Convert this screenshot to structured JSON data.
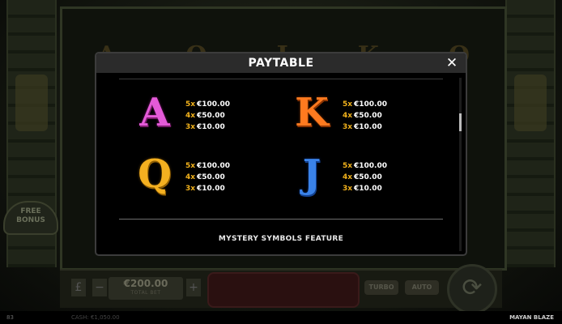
{
  "game": {
    "title": "MAYAN BLAZE",
    "reel_letters": [
      "A",
      "Q",
      "J",
      "K",
      "Q"
    ],
    "free_bonus_label": "FREE BONUS",
    "bet": {
      "value": "€200.00",
      "label": "TOTAL BET"
    },
    "turbo_label": "TURBO",
    "auto_label": "AUTO",
    "cash_label": "CASH: €1,050.00",
    "footer_left": "83"
  },
  "paytable": {
    "title": "PAYTABLE",
    "close_icon": "✕",
    "symbols": [
      {
        "letter": "A",
        "color": "#e45ad8",
        "pays": [
          {
            "mult": "5x",
            "value": "€100.00"
          },
          {
            "mult": "4x",
            "value": "€50.00"
          },
          {
            "mult": "3x",
            "value": "€10.00"
          }
        ]
      },
      {
        "letter": "K",
        "color": "#ff7a1f",
        "pays": [
          {
            "mult": "5x",
            "value": "€100.00"
          },
          {
            "mult": "4x",
            "value": "€50.00"
          },
          {
            "mult": "3x",
            "value": "€10.00"
          }
        ]
      },
      {
        "letter": "Q",
        "color": "#f4b020",
        "pays": [
          {
            "mult": "5x",
            "value": "€100.00"
          },
          {
            "mult": "4x",
            "value": "€50.00"
          },
          {
            "mult": "3x",
            "value": "€10.00"
          }
        ]
      },
      {
        "letter": "J",
        "color": "#3a82e8",
        "pays": [
          {
            "mult": "5x",
            "value": "€100.00"
          },
          {
            "mult": "4x",
            "value": "€50.00"
          },
          {
            "mult": "3x",
            "value": "€10.00"
          }
        ]
      }
    ],
    "section_heading": "MYSTERY SYMBOLS FEATURE"
  },
  "colors": {
    "multiplier": "#f2b21c",
    "header_bg": "#2b2b2b",
    "modal_bg": "#000000"
  }
}
